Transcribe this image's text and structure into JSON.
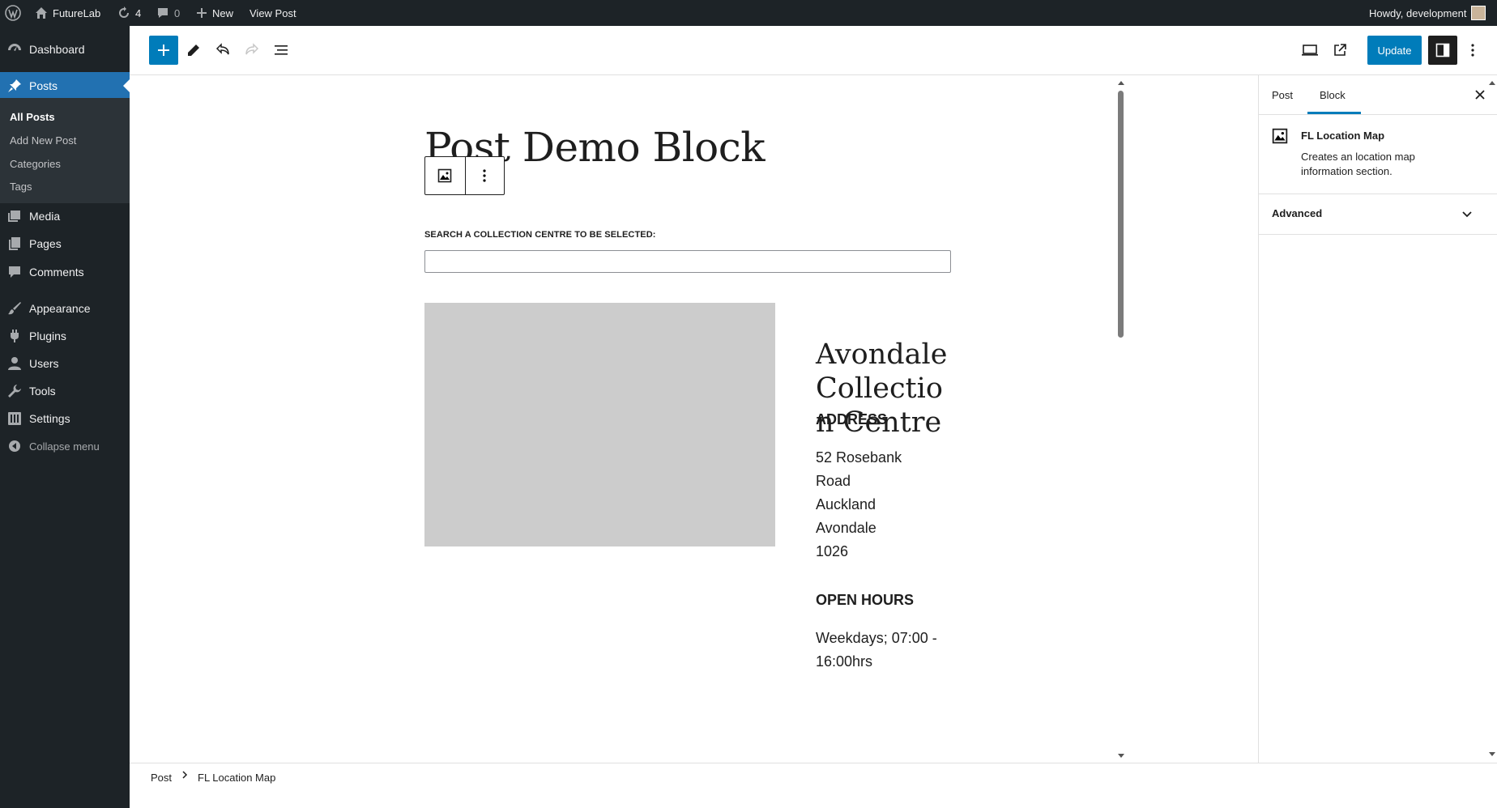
{
  "admin_bar": {
    "site_name": "FutureLab",
    "updates_count": "4",
    "comments_count": "0",
    "new_label": "New",
    "view_post_label": "View Post",
    "howdy": "Howdy, development"
  },
  "menu": {
    "dashboard": "Dashboard",
    "posts": "Posts",
    "sub": {
      "all_posts": "All Posts",
      "add_new": "Add New Post",
      "categories": "Categories",
      "tags": "Tags"
    },
    "media": "Media",
    "pages": "Pages",
    "comments": "Comments",
    "appearance": "Appearance",
    "plugins": "Plugins",
    "users": "Users",
    "tools": "Tools",
    "settings": "Settings",
    "collapse": "Collapse menu"
  },
  "toolbar": {
    "update_label": "Update"
  },
  "post": {
    "title": "Post Demo Block",
    "search_label": "SEARCH A COLLECTION CENTRE TO BE SELECTED:",
    "search_value": "",
    "location_title": "Avondale Collection Centre",
    "address_heading": "ADDRESS",
    "address_lines": [
      "52 Rosebank",
      "Road",
      "Auckland",
      "Avondale",
      "1026"
    ],
    "hours_heading": "OPEN HOURS",
    "hours_lines": [
      "Weekdays; 07:00 -",
      "16:00hrs"
    ]
  },
  "sidebar": {
    "tab_post": "Post",
    "tab_block": "Block",
    "block_name": "FL Location Map",
    "block_description": "Creates an location map information section.",
    "advanced_label": "Advanced"
  },
  "breadcrumb": {
    "root": "Post",
    "current": "FL Location Map"
  },
  "colors": {
    "admin_dark": "#1d2327",
    "accent": "#007cba",
    "menu_current": "#2271b1",
    "map_placeholder": "#cccccc"
  }
}
